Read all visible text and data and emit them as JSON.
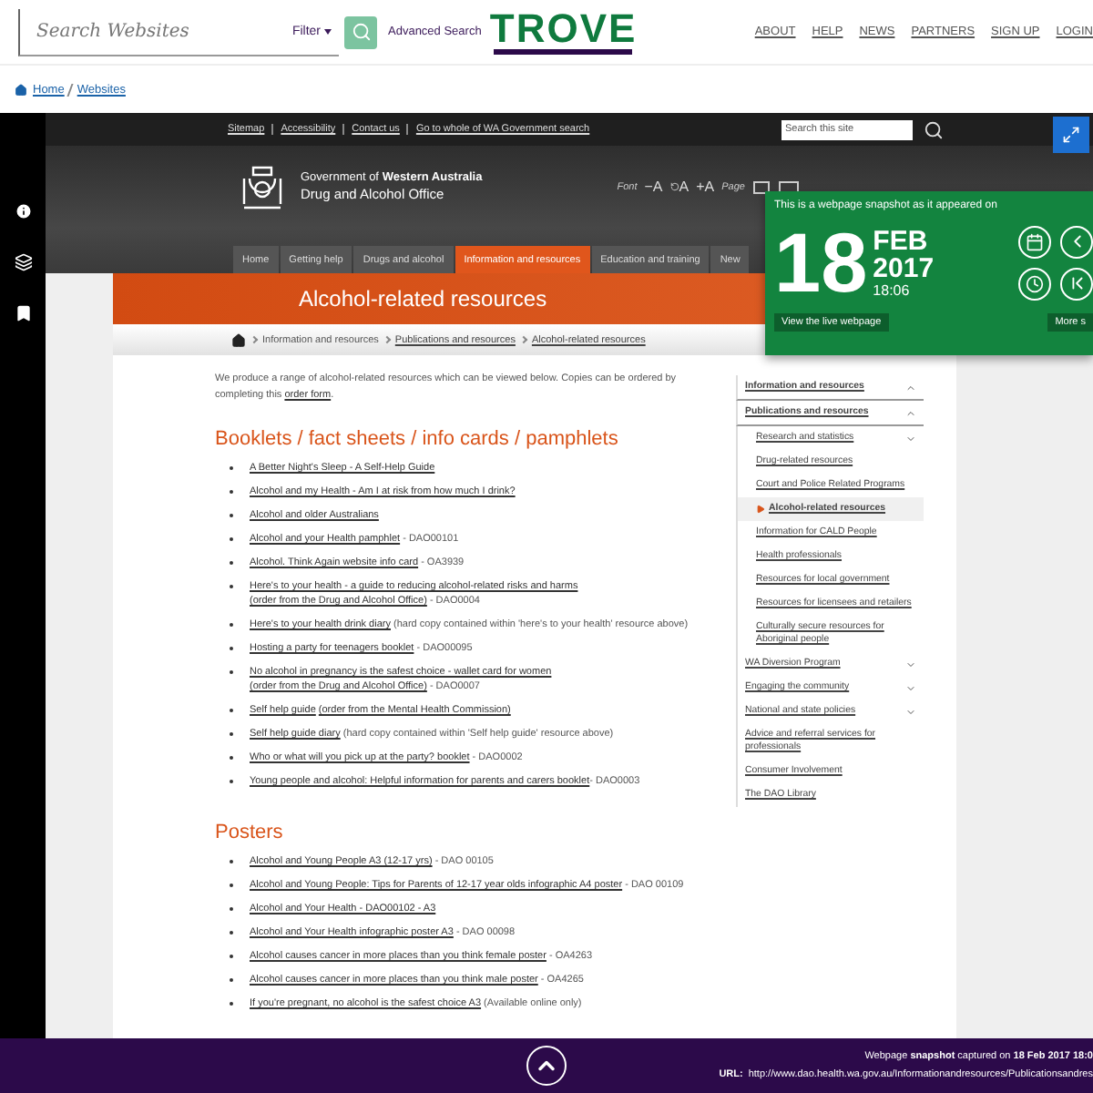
{
  "trove": {
    "search": {
      "placeholder": "Search Websites"
    },
    "filter": "Filter",
    "advanced_search": "Advanced Search",
    "logo": "TROVE",
    "nav": [
      "ABOUT",
      "HELP",
      "NEWS",
      "PARTNERS",
      "SIGN UP",
      "LOGIN"
    ]
  },
  "breadcrumb": [
    "Home",
    "Websites"
  ],
  "site": {
    "utility_links": [
      "Sitemap",
      "Accessibility",
      "Contact us",
      "Go to whole of WA Government search"
    ],
    "site_search": {
      "placeholder": "Search this site"
    },
    "government": "Government of **Western Australia**",
    "agency": "Drug and Alcohol Office",
    "font_label": "Font",
    "font_controls": [
      "−A",
      "A",
      "+A"
    ],
    "page_label": "Page",
    "tabs": [
      {
        "label": "Home",
        "selected": false
      },
      {
        "label": "Getting help",
        "selected": false
      },
      {
        "label": "Drugs and alcohol",
        "selected": false
      },
      {
        "label": "Information and resources",
        "selected": true
      },
      {
        "label": "Education and training",
        "selected": false
      },
      {
        "label": "New",
        "selected": false
      }
    ],
    "title": "Alcohol-related resources",
    "crumbs": [
      {
        "label": "Information and resources",
        "kind": "text"
      },
      {
        "label": "Publications and resources",
        "kind": "link"
      },
      {
        "label": "Alcohol-related resources",
        "kind": "link"
      }
    ],
    "intro": [
      {
        "text": "We produce a range of alcohol-related resources which can be viewed below. Copies can be ordered by completing this ",
        "kind": "text"
      },
      {
        "text": "order form",
        "kind": "link"
      },
      {
        "text": ".",
        "kind": "text"
      }
    ],
    "sections": [
      {
        "heading": "Booklets / fact sheets / info cards / pamphlets",
        "items": [
          [
            {
              "text": "A Better Night's Sleep - A Self-Help Guide",
              "kind": "link"
            }
          ],
          [
            {
              "text": "Alcohol and my Health - Am I at risk from how much I drink?",
              "kind": "link"
            }
          ],
          [
            {
              "text": "Alcohol and older Australians",
              "kind": "link"
            }
          ],
          [
            {
              "text": "Alcohol and your Health pamphlet",
              "kind": "link"
            },
            {
              "text": " - DAO00101",
              "kind": "text"
            }
          ],
          [
            {
              "text": "Alcohol. Think Again website info card",
              "kind": "link"
            },
            {
              "text": " - OA3939",
              "kind": "text"
            }
          ],
          [
            {
              "text": "Here's to your health - a guide to reducing alcohol-related risks and harms",
              "kind": "link"
            },
            {
              "text": "(order from the Drug and Alcohol Office)",
              "kind": "link"
            },
            {
              "text": " - DAO0004",
              "kind": "text"
            }
          ],
          [
            {
              "text": "Here's to your health drink diary",
              "kind": "link"
            },
            {
              "text": " (hard copy contained within 'here's to your health' resource above)",
              "kind": "text"
            }
          ],
          [
            {
              "text": "Hosting a party for teenagers booklet",
              "kind": "link"
            },
            {
              "text": " - DAO00095",
              "kind": "text"
            }
          ],
          [
            {
              "text": "No alcohol in pregnancy is the safest choice - wallet card for women",
              "kind": "link"
            },
            {
              "text": "(order from the Drug and Alcohol Office)",
              "kind": "link"
            },
            {
              "text": " - DAO0007",
              "kind": "text"
            }
          ],
          [
            {
              "text": "Self help guide",
              "kind": "link"
            },
            {
              "text": "(order from the Mental Health Commission)",
              "kind": "link"
            }
          ],
          [
            {
              "text": "Self help guide diary",
              "kind": "link"
            },
            {
              "text": " (hard copy contained within 'Self help guide' resource above)",
              "kind": "text"
            }
          ],
          [
            {
              "text": "Who or what will you pick up at the party? booklet",
              "kind": "link"
            },
            {
              "text": " - DAO0002",
              "kind": "text"
            }
          ],
          [
            {
              "text": "Young people and alcohol: Helpful information for parents and carers booklet",
              "kind": "link"
            },
            {
              "text": "- DAO0003",
              "kind": "text"
            }
          ]
        ]
      },
      {
        "heading": "Posters",
        "items": [
          [
            {
              "text": "Alcohol and Young People A3 (12-17 yrs)",
              "kind": "link"
            },
            {
              "text": " - DAO 00105",
              "kind": "text"
            }
          ],
          [
            {
              "text": "Alcohol and Young People: Tips for Parents of 12-17 year olds infographic A4 poster",
              "kind": "link"
            },
            {
              "text": " - DAO 00109",
              "kind": "text"
            }
          ],
          [
            {
              "text": "Alcohol and Your Health - DAO00102 - A3",
              "kind": "link"
            }
          ],
          [
            {
              "text": "Alcohol and Your Health infographic poster A3",
              "kind": "link"
            },
            {
              "text": " - DAO 00098",
              "kind": "text"
            }
          ],
          [
            {
              "text": "Alcohol causes cancer in more places than you think female poster",
              "kind": "link"
            },
            {
              "text": " - OA4263",
              "kind": "text"
            }
          ],
          [
            {
              "text": "Alcohol causes cancer in more places than you think male poster",
              "kind": "link"
            },
            {
              "text": " - OA4265",
              "kind": "text"
            }
          ],
          [
            {
              "text": "If you're pregnant, no alcohol is the safest choice A3",
              "kind": "link"
            },
            {
              "text": " (Available online only)",
              "kind": "text"
            }
          ]
        ]
      }
    ],
    "sidebar": [
      {
        "label": "Information and resources",
        "selected": false,
        "expanded": true,
        "children": [
          {
            "label": "Publications and resources",
            "selected": false,
            "expanded": true,
            "children": [
              {
                "label": "Research and statistics",
                "selected": false,
                "expanded": false
              },
              {
                "label": "Drug-related resources",
                "selected": false
              },
              {
                "label": "Court and Police Related Programs",
                "selected": false
              },
              {
                "label": "Alcohol-related resources",
                "selected": true
              },
              {
                "label": "Information for CALD People",
                "selected": false
              },
              {
                "label": "Health professionals",
                "selected": false
              },
              {
                "label": "Resources for local government",
                "selected": false
              },
              {
                "label": "Resources for licensees and retailers",
                "selected": false
              },
              {
                "label": "Culturally secure resources for Aboriginal people",
                "selected": false
              }
            ]
          },
          {
            "label": "WA Diversion Program",
            "selected": false,
            "expanded": false
          },
          {
            "label": "Engaging the community",
            "selected": false,
            "expanded": false
          },
          {
            "label": "National and state policies",
            "selected": false,
            "expanded": false
          },
          {
            "label": "Advice and referral services for professionals",
            "selected": false
          },
          {
            "label": "Consumer Involvement",
            "selected": false
          },
          {
            "label": "The DAO Library",
            "selected": false
          }
        ]
      }
    ]
  },
  "snapshot": {
    "caption": "This is a webpage snapshot as it appeared on",
    "day": "18",
    "month": "FEB",
    "year": "2017",
    "time": "18:06",
    "live_button": "View the live webpage",
    "more_button": "More s"
  },
  "footer": {
    "captured": "Webpage **snapshot** captured on **18 Feb 2017 18:0**",
    "url_label": "URL:",
    "url": "http://www.dao.health.wa.gov.au/Informationandresources/Publicationsandres"
  }
}
